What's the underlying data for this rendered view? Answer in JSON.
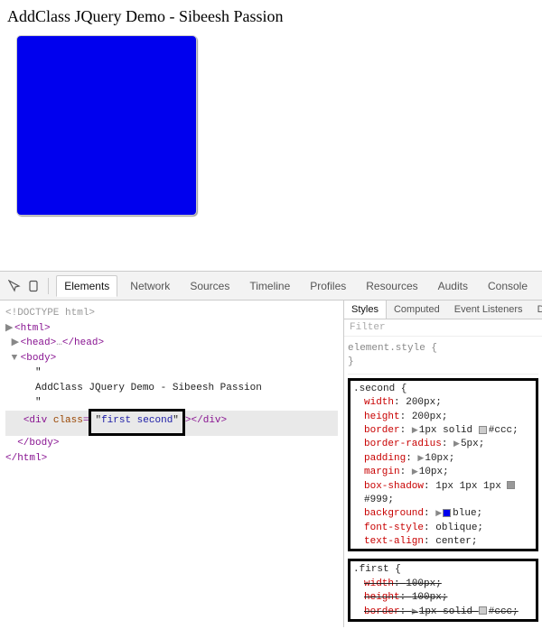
{
  "page": {
    "title": "AddClass JQuery Demo - Sibeesh Passion"
  },
  "devtools": {
    "tabs": [
      "Elements",
      "Network",
      "Sources",
      "Timeline",
      "Profiles",
      "Resources",
      "Audits",
      "Console"
    ],
    "activeTab": "Elements",
    "elements": {
      "doctype": "<!DOCTYPE html>",
      "html_open": "html",
      "head": "head",
      "body": "body",
      "text_node_q1": "\"",
      "text_node_title": "AddClass JQuery Demo - Sibeesh Passion",
      "text_node_q2": "\"",
      "div_open_prefix": "<div class=",
      "div_class_value": "first second",
      "div_close": "</div>",
      "body_close": "</body>",
      "html_close": "</html>"
    },
    "styles": {
      "tabs": [
        "Styles",
        "Computed",
        "Event Listeners",
        "DOM"
      ],
      "activeTab": "Styles",
      "filter_placeholder": "Filter",
      "element_style_label": "element.style {",
      "close_brace": "}",
      "rule_second": {
        "selector": ".second {",
        "decls": [
          {
            "prop": "width",
            "val": "200px;"
          },
          {
            "prop": "height",
            "val": "200px;"
          },
          {
            "prop": "border",
            "arrow": true,
            "val_pre": "1px solid ",
            "swatch": "#cccccc",
            "val_post": "#ccc;"
          },
          {
            "prop": "border-radius",
            "arrow": true,
            "val": "5px;"
          },
          {
            "prop": "padding",
            "arrow": true,
            "val": "10px;"
          },
          {
            "prop": "margin",
            "arrow": true,
            "val": "10px;"
          },
          {
            "prop": "box-shadow",
            "val_pre": "1px 1px 1px ",
            "swatch": "#999999",
            "val_post": "#999;"
          },
          {
            "prop": "background",
            "arrow": true,
            "swatch": "#0000ee",
            "val_post": "blue;",
            "val_pre": ""
          },
          {
            "prop": "font-style",
            "val": "oblique;"
          },
          {
            "prop": "text-align",
            "val": "center;"
          }
        ]
      },
      "rule_first": {
        "selector": ".first {",
        "decls": [
          {
            "prop": "width",
            "val": "100px;",
            "strike": true
          },
          {
            "prop": "height",
            "val": "100px;",
            "strike": true
          },
          {
            "prop": "border",
            "arrow": true,
            "val_pre": "1px solid ",
            "swatch": "#cccccc",
            "val_post": "#ccc;",
            "strike": true
          }
        ]
      }
    }
  }
}
